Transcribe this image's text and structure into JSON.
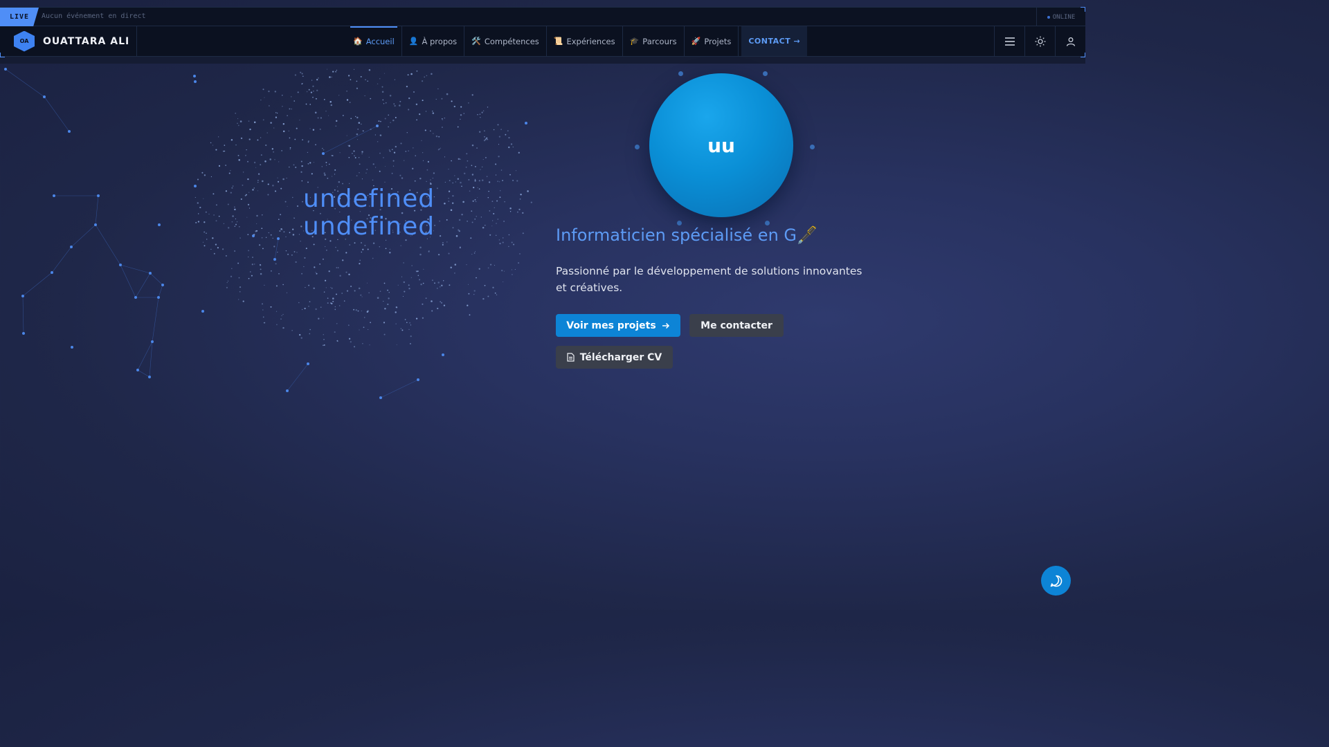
{
  "topbar": {
    "live_label": "LIVE",
    "live_text": "Aucun événement en direct",
    "status_label": "ONLINE"
  },
  "brand": {
    "logo_text": "OA",
    "name": "OUATTARA ALI"
  },
  "nav": {
    "items": [
      {
        "icon": "🏠",
        "label": "Accueil",
        "active": true
      },
      {
        "icon": "👤",
        "label": "À propos"
      },
      {
        "icon": "🛠️",
        "label": "Compétences"
      },
      {
        "icon": "📜",
        "label": "Expériences"
      },
      {
        "icon": "🎓",
        "label": "Parcours"
      },
      {
        "icon": "🚀",
        "label": "Projets"
      }
    ],
    "contact_label": "CONTACT →",
    "right_icons": [
      "menu-icon",
      "sun-icon",
      "user-icon"
    ]
  },
  "hero": {
    "title_line1": "undefined",
    "title_line2": "undefined",
    "avatar_initials": "uu",
    "role": "Informaticien spécialisé en G🖋️",
    "tagline": "Passionné par le développement de solutions innovantes et créatives.",
    "primary_button": "Voir mes projets",
    "secondary_button": "Me contacter",
    "cv_button": "Télécharger CV"
  },
  "colors": {
    "accent": "#4f8ef7",
    "primary_button": "#0d84d6",
    "background": "#252d57"
  },
  "chat": {
    "icon": "chat-bubble-icon"
  }
}
